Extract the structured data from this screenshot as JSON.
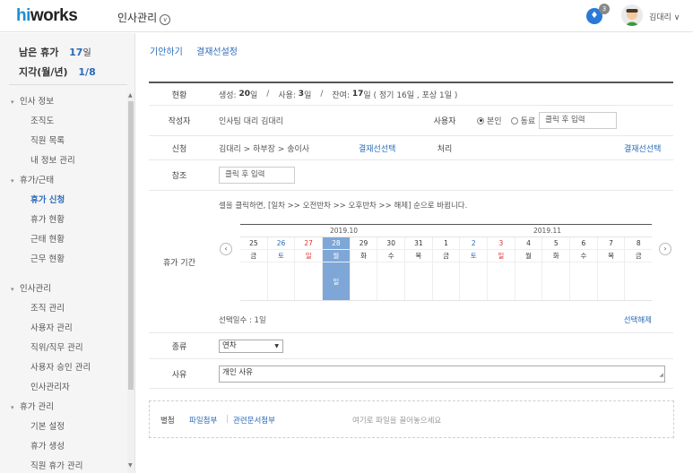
{
  "header": {
    "logo_hi": "hi",
    "logo_rest": "works",
    "app_title": "인사관리",
    "notification_count": "3",
    "username": "김대리"
  },
  "sidebar": {
    "summary": {
      "remaining_label": "남은 휴가",
      "remaining_value": "17",
      "remaining_unit": "일",
      "late_label": "지각(월/년)",
      "late_value": "1/8"
    },
    "groups": [
      {
        "label": "인사 정보",
        "items": [
          "조직도",
          "직원 목록",
          "내 정보 관리"
        ]
      },
      {
        "label": "휴가/근태",
        "items": [
          "휴가 신청",
          "휴가 현황",
          "근태 현황",
          "근무 현황"
        ]
      },
      {
        "label": "인사관리",
        "items": [
          "조직 관리",
          "사용자 관리",
          "직위/직무 관리",
          "사용자 승인 관리",
          "인사관리자"
        ]
      },
      {
        "label": "휴가 관리",
        "items": [
          "기본 설정",
          "휴가 생성",
          "직원 휴가 관리"
        ]
      }
    ],
    "active_item": "휴가 신청"
  },
  "tabs": [
    "기안하기",
    "결재선설정"
  ],
  "form": {
    "status": {
      "label": "현황",
      "created_label": "생성:",
      "created_value": "20",
      "created_unit": "일",
      "used_label": "사용:",
      "used_value": "3",
      "used_unit": "일",
      "balance_label": "잔여:",
      "balance_value": "17",
      "balance_detail": "일 ( 정기 16일 , 포상 1일 )"
    },
    "author": {
      "label": "작성자",
      "value": "인사팀 대리 김대리",
      "user_label": "사용자",
      "radio_self": "본인",
      "radio_colleague": "동료",
      "colleague_placeholder": "클릭 후 입력"
    },
    "apply": {
      "label": "신청",
      "path": "김대리 > 하부장 > 송이사",
      "select_line": "결재선선택",
      "process_label": "처리",
      "process_select_line": "결재선선택"
    },
    "reference": {
      "label": "참조",
      "placeholder": "클릭 후 입력"
    },
    "period": {
      "label": "휴가 기간",
      "note": "셀을 클릭하면, [일차 >> 오전반차 >> 오후반차 >> 해제] 순으로 바뀝니다.",
      "month1": "2019.10",
      "month2": "2019.11",
      "days": [
        {
          "d": "25",
          "w": "금",
          "type": ""
        },
        {
          "d": "26",
          "w": "토",
          "type": "sat"
        },
        {
          "d": "27",
          "w": "일",
          "type": "sun"
        },
        {
          "d": "28",
          "w": "월",
          "type": "sel"
        },
        {
          "d": "29",
          "w": "화",
          "type": ""
        },
        {
          "d": "30",
          "w": "수",
          "type": ""
        },
        {
          "d": "31",
          "w": "목",
          "type": ""
        },
        {
          "d": "1",
          "w": "금",
          "type": ""
        },
        {
          "d": "2",
          "w": "토",
          "type": "sat"
        },
        {
          "d": "3",
          "w": "일",
          "type": "sun"
        },
        {
          "d": "4",
          "w": "월",
          "type": ""
        },
        {
          "d": "5",
          "w": "화",
          "type": ""
        },
        {
          "d": "6",
          "w": "수",
          "type": ""
        },
        {
          "d": "7",
          "w": "목",
          "type": ""
        },
        {
          "d": "8",
          "w": "금",
          "type": ""
        }
      ],
      "selected_cell_text": "일",
      "selected_days": "선택일수 : 1일",
      "clear_selection": "선택해제"
    },
    "type": {
      "label": "종류",
      "selected": "연차"
    },
    "reason": {
      "label": "사유",
      "value": "개인 사유"
    }
  },
  "attachments": {
    "label": "별첨",
    "file_attach": "파일첨부",
    "doc_attach": "관련문서첨부",
    "hint": "여기로 파일을 끌어놓으세요"
  },
  "colors": {
    "accent": "#2b6cb8",
    "selected_cell": "#7ea7d8",
    "sunday": "#d9342b",
    "bell": "#2979d9"
  }
}
